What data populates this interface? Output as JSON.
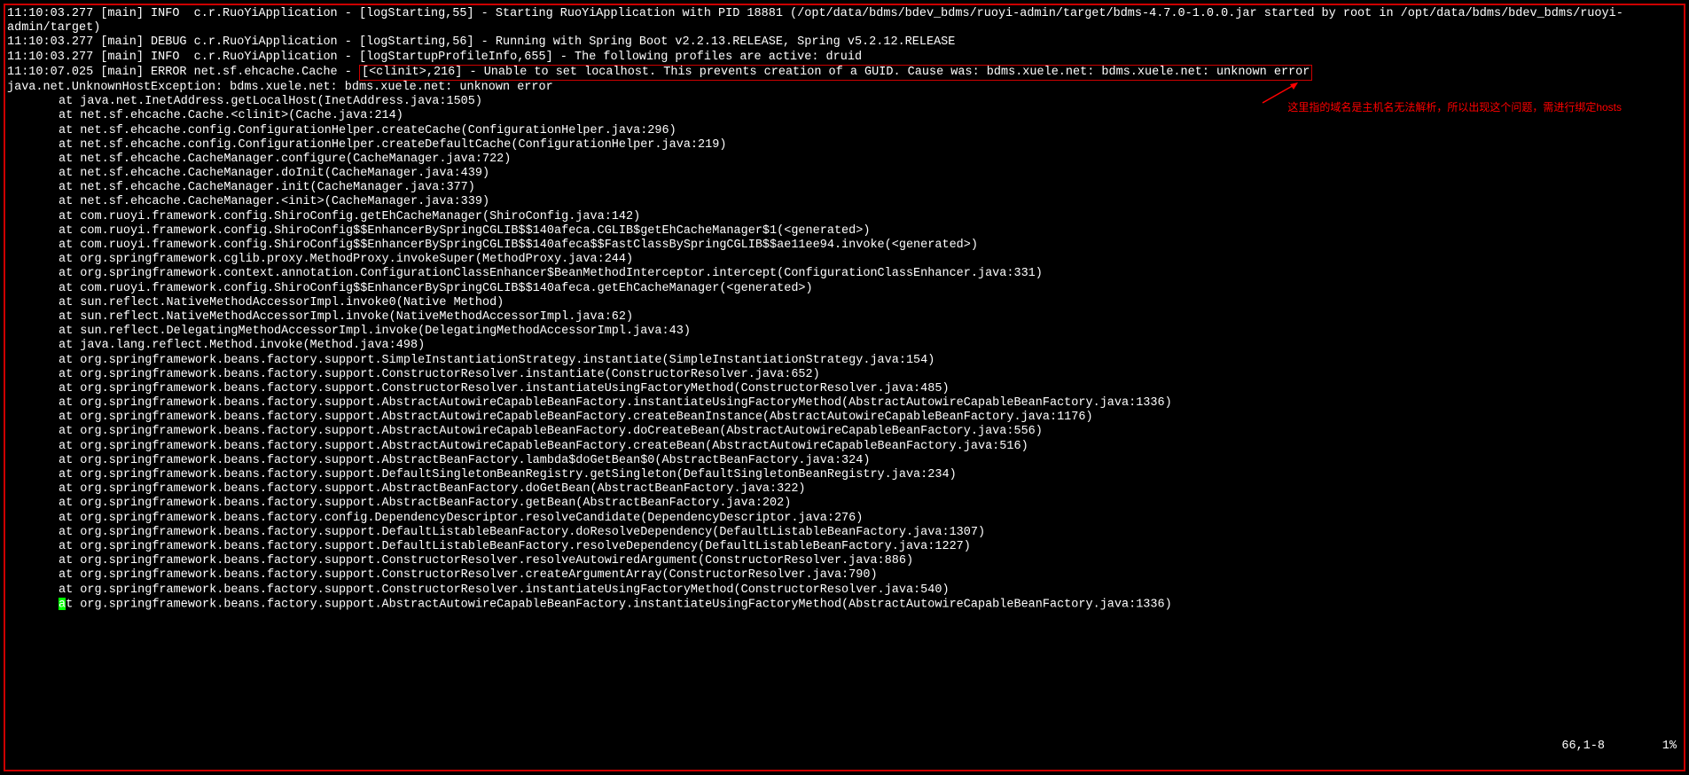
{
  "log_lines": [
    "11:10:03.277 [main] INFO  c.r.RuoYiApplication - [logStarting,55] - Starting RuoYiApplication with PID 18881 (/opt/data/bdms/bdev_bdms/ruoyi-admin/target/bdms-4.7.0-1.0.0.jar started by root in /opt/data/bdms/bdev_bdms/ruoyi-admin/target)",
    "11:10:03.277 [main] DEBUG c.r.RuoYiApplication - [logStarting,56] - Running with Spring Boot v2.2.13.RELEASE, Spring v5.2.12.RELEASE",
    "11:10:03.277 [main] INFO  c.r.RuoYiApplication - [logStartupProfileInfo,655] - The following profiles are active: druid"
  ],
  "error_line_prefix": "11:10:07.025 [main] ERROR net.sf.ehcache.Cache - ",
  "error_line_boxed": "[<clinit>,216] - Unable to set localhost. This prevents creation of a GUID. Cause was: bdms.xuele.net: bdms.xuele.net: unknown error",
  "exception_line": "java.net.UnknownHostException: bdms.xuele.net: bdms.xuele.net: unknown error",
  "stack_trace": [
    "at java.net.InetAddress.getLocalHost(InetAddress.java:1505)",
    "at net.sf.ehcache.Cache.<clinit>(Cache.java:214)",
    "at net.sf.ehcache.config.ConfigurationHelper.createCache(ConfigurationHelper.java:296)",
    "at net.sf.ehcache.config.ConfigurationHelper.createDefaultCache(ConfigurationHelper.java:219)",
    "at net.sf.ehcache.CacheManager.configure(CacheManager.java:722)",
    "at net.sf.ehcache.CacheManager.doInit(CacheManager.java:439)",
    "at net.sf.ehcache.CacheManager.init(CacheManager.java:377)",
    "at net.sf.ehcache.CacheManager.<init>(CacheManager.java:339)",
    "at com.ruoyi.framework.config.ShiroConfig.getEhCacheManager(ShiroConfig.java:142)",
    "at com.ruoyi.framework.config.ShiroConfig$$EnhancerBySpringCGLIB$$140afeca.CGLIB$getEhCacheManager$1(<generated>)",
    "at com.ruoyi.framework.config.ShiroConfig$$EnhancerBySpringCGLIB$$140afeca$$FastClassBySpringCGLIB$$ae11ee94.invoke(<generated>)",
    "at org.springframework.cglib.proxy.MethodProxy.invokeSuper(MethodProxy.java:244)",
    "at org.springframework.context.annotation.ConfigurationClassEnhancer$BeanMethodInterceptor.intercept(ConfigurationClassEnhancer.java:331)",
    "at com.ruoyi.framework.config.ShiroConfig$$EnhancerBySpringCGLIB$$140afeca.getEhCacheManager(<generated>)",
    "at sun.reflect.NativeMethodAccessorImpl.invoke0(Native Method)",
    "at sun.reflect.NativeMethodAccessorImpl.invoke(NativeMethodAccessorImpl.java:62)",
    "at sun.reflect.DelegatingMethodAccessorImpl.invoke(DelegatingMethodAccessorImpl.java:43)",
    "at java.lang.reflect.Method.invoke(Method.java:498)",
    "at org.springframework.beans.factory.support.SimpleInstantiationStrategy.instantiate(SimpleInstantiationStrategy.java:154)",
    "at org.springframework.beans.factory.support.ConstructorResolver.instantiate(ConstructorResolver.java:652)",
    "at org.springframework.beans.factory.support.ConstructorResolver.instantiateUsingFactoryMethod(ConstructorResolver.java:485)",
    "at org.springframework.beans.factory.support.AbstractAutowireCapableBeanFactory.instantiateUsingFactoryMethod(AbstractAutowireCapableBeanFactory.java:1336)",
    "at org.springframework.beans.factory.support.AbstractAutowireCapableBeanFactory.createBeanInstance(AbstractAutowireCapableBeanFactory.java:1176)",
    "at org.springframework.beans.factory.support.AbstractAutowireCapableBeanFactory.doCreateBean(AbstractAutowireCapableBeanFactory.java:556)",
    "at org.springframework.beans.factory.support.AbstractAutowireCapableBeanFactory.createBean(AbstractAutowireCapableBeanFactory.java:516)",
    "at org.springframework.beans.factory.support.AbstractBeanFactory.lambda$doGetBean$0(AbstractBeanFactory.java:324)",
    "at org.springframework.beans.factory.support.DefaultSingletonBeanRegistry.getSingleton(DefaultSingletonBeanRegistry.java:234)",
    "at org.springframework.beans.factory.support.AbstractBeanFactory.doGetBean(AbstractBeanFactory.java:322)",
    "at org.springframework.beans.factory.support.AbstractBeanFactory.getBean(AbstractBeanFactory.java:202)",
    "at org.springframework.beans.factory.config.DependencyDescriptor.resolveCandidate(DependencyDescriptor.java:276)",
    "at org.springframework.beans.factory.support.DefaultListableBeanFactory.doResolveDependency(DefaultListableBeanFactory.java:1307)",
    "at org.springframework.beans.factory.support.DefaultListableBeanFactory.resolveDependency(DefaultListableBeanFactory.java:1227)",
    "at org.springframework.beans.factory.support.ConstructorResolver.resolveAutowiredArgument(ConstructorResolver.java:886)",
    "at org.springframework.beans.factory.support.ConstructorResolver.createArgumentArray(ConstructorResolver.java:790)",
    "at org.springframework.beans.factory.support.ConstructorResolver.instantiateUsingFactoryMethod(ConstructorResolver.java:540)",
    "at org.springframework.beans.factory.support.AbstractAutowireCapableBeanFactory.instantiateUsingFactoryMethod(AbstractAutowireCapableBeanFactory.java:1336)"
  ],
  "annotation_text": "这里指的域名是主机名无法解析，所以出现这个问题，需进行绑定hosts",
  "status_position": "66,1-8",
  "status_percent": "1%"
}
